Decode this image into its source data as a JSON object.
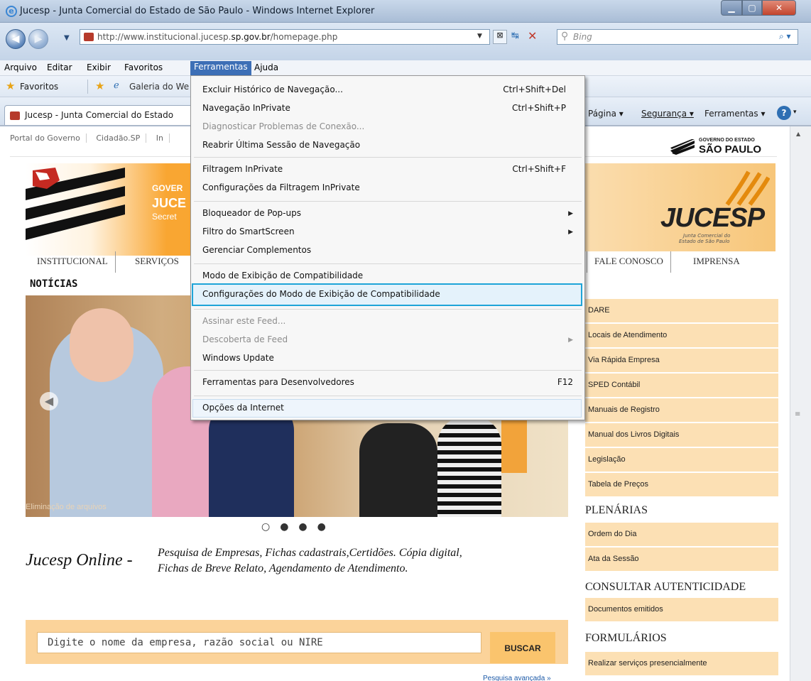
{
  "window": {
    "title": "Jucesp - Junta Comercial do Estado de São Paulo - Windows Internet Explorer",
    "minimize_icon": "minimize-icon",
    "maximize_icon": "maximize-icon",
    "close_icon": "close-icon"
  },
  "address_bar": {
    "url_prefix": "http://www.institucional.jucesp.",
    "url_domain": "sp.gov.br",
    "url_suffix": "/homepage.php",
    "search_placeholder": "Bing"
  },
  "menu_bar": [
    "Arquivo",
    "Editar",
    "Exibir",
    "Favoritos",
    "Ferramentas",
    "Ajuda"
  ],
  "favorites_bar": {
    "favorites": "Favoritos",
    "gallery": "Galeria do We"
  },
  "tab": {
    "label": "Jucesp - Junta Comercial do Estado"
  },
  "command_bar": {
    "page": "Página ▾",
    "security": "Segurança ▾",
    "tools": "Ferramentas ▾"
  },
  "page": {
    "top_nav": [
      "Portal do Governo",
      "Cidadão.SP",
      "In"
    ],
    "gov_logo_line1": "GOVERNO DO ESTADO",
    "gov_logo_line2": "SÃO PAULO",
    "banner_line1": "GOVER",
    "banner_line2": "JUCE",
    "banner_line3": "Secret",
    "jucesp_logo": "JUCESP",
    "jucesp_sub1": "Junta Comercial do",
    "jucesp_sub2": "Estado de São Paulo",
    "nav_tabs": [
      "INSTITUCIONAL",
      "SERVIÇOS"
    ],
    "right_tabs": [
      "FALE CONOSCO",
      "IMPRENSA"
    ],
    "noticias": "NOTÍCIAS",
    "caption": "Eliminação de arquivos",
    "online_title": "Jucesp Online -",
    "online_desc1": "Pesquisa de Empresas, Fichas cadastrais,Certidões. Cópia digital,",
    "online_desc2": "Fichas de Breve Relato, Agendamento de Atendimento.",
    "search_placeholder": "Digite o nome da empresa, razão social ou NIRE",
    "search_button": "BUSCAR",
    "advanced": "Pesquisa avançada »",
    "sidebar_links": [
      "DARE",
      "Locais de Atendimento",
      "Via Rápida Empresa",
      "SPED Contábil",
      "Manuais de Registro",
      "Manual dos Livros Digitais",
      "Legislação",
      "Tabela de Preços"
    ],
    "plenarias_head": "PLENÁRIAS",
    "plenarias_links": [
      "Ordem do Dia",
      "Ata da Sessão"
    ],
    "autenticidade_head": "CONSULTAR AUTENTICIDADE",
    "autenticidade_links": [
      "Documentos emitidos"
    ],
    "formularios_head": "FORMULÁRIOS",
    "formularios_links": [
      "Realizar serviços presencialmente"
    ]
  },
  "dropdown": {
    "items": [
      {
        "label": "Excluir Histórico de Navegação...",
        "shortcut": "Ctrl+Shift+Del"
      },
      {
        "label": "Navegação InPrivate",
        "shortcut": "Ctrl+Shift+P"
      },
      {
        "label": "Diagnosticar Problemas de Conexão...",
        "shortcut": ""
      },
      {
        "label": "Reabrir Última Sessão de Navegação",
        "shortcut": ""
      },
      {
        "label": "Filtragem InPrivate",
        "shortcut": "Ctrl+Shift+F"
      },
      {
        "label": "Configurações da Filtragem InPrivate",
        "shortcut": ""
      },
      {
        "label": "Bloqueador de Pop-ups",
        "shortcut": ""
      },
      {
        "label": "Filtro do SmartScreen",
        "shortcut": ""
      },
      {
        "label": "Gerenciar Complementos",
        "shortcut": ""
      },
      {
        "label": "Modo de Exibição de Compatibilidade",
        "shortcut": ""
      },
      {
        "label": "Configurações do Modo de Exibição de Compatibilidade",
        "shortcut": ""
      },
      {
        "label": "Assinar este Feed...",
        "shortcut": ""
      },
      {
        "label": "Descoberta de Feed",
        "shortcut": ""
      },
      {
        "label": "Windows Update",
        "shortcut": ""
      },
      {
        "label": "Ferramentas para Desenvolvedores",
        "shortcut": "F12"
      },
      {
        "label": "Opções da Internet",
        "shortcut": ""
      }
    ]
  }
}
